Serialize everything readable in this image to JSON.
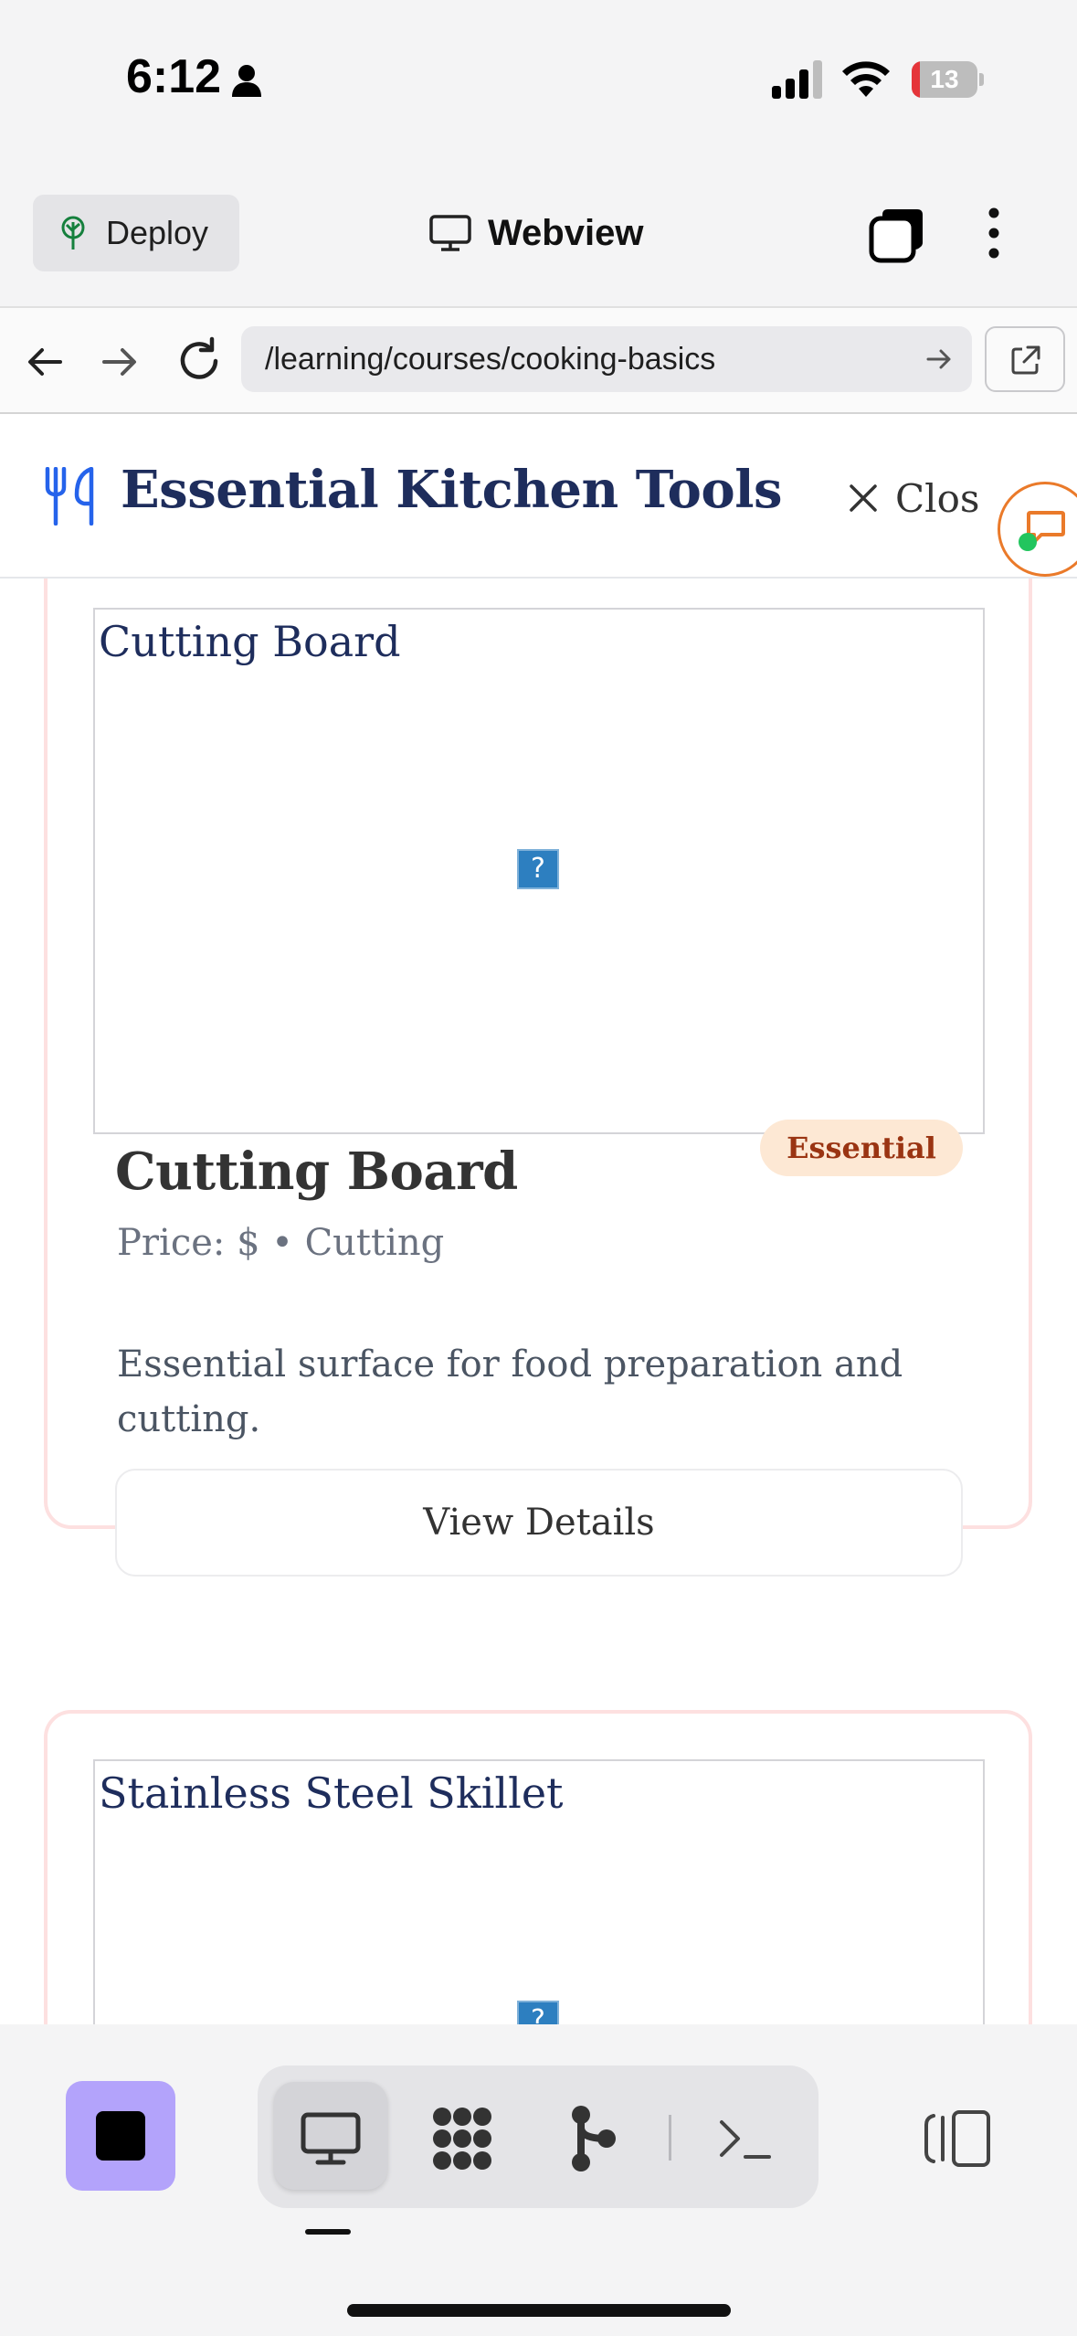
{
  "status_bar": {
    "time": "6:12",
    "battery_level": "13",
    "battery_fraction": 0.13
  },
  "app_bar": {
    "deploy_label": "Deploy",
    "webview_label": "Webview"
  },
  "url_bar": {
    "url": "/learning/courses/cooking-basics"
  },
  "page": {
    "title": "Essential Kitchen Tools",
    "close_label": "Close",
    "close_label_visible": "Clos"
  },
  "cards": [
    {
      "image_alt": "Cutting Board",
      "name": "Cutting Board",
      "badge": "Essential",
      "meta": "Price: $ • Cutting",
      "description": "Essential surface for food preparation and cutting.",
      "button_label": "View Details"
    },
    {
      "image_alt": "Stainless Steel Skillet"
    }
  ],
  "broken_image_glyph": "?",
  "colors": {
    "title_navy": "#1e2d5c",
    "accent_blue": "#2563eb",
    "card_border": "#fde0e0",
    "badge_bg": "#fde8d4",
    "badge_text": "#9a3412",
    "stop_button": "#b3a3fb",
    "chat_fab_border": "#ea7a2a",
    "online_dot": "#22c55e"
  },
  "icons": [
    "person-icon",
    "signal-icon",
    "wifi-icon",
    "battery-icon",
    "deploy-tree-icon",
    "monitor-icon",
    "tabs-icon",
    "kebab-menu-icon",
    "back-arrow-icon",
    "forward-arrow-icon",
    "reload-icon",
    "go-arrow-icon",
    "open-external-icon",
    "utensils-icon",
    "close-icon",
    "chat-icon",
    "stop-icon",
    "desktop-icon",
    "apps-grid-icon",
    "branch-icon",
    "terminal-icon",
    "panel-toggle-icon"
  ]
}
